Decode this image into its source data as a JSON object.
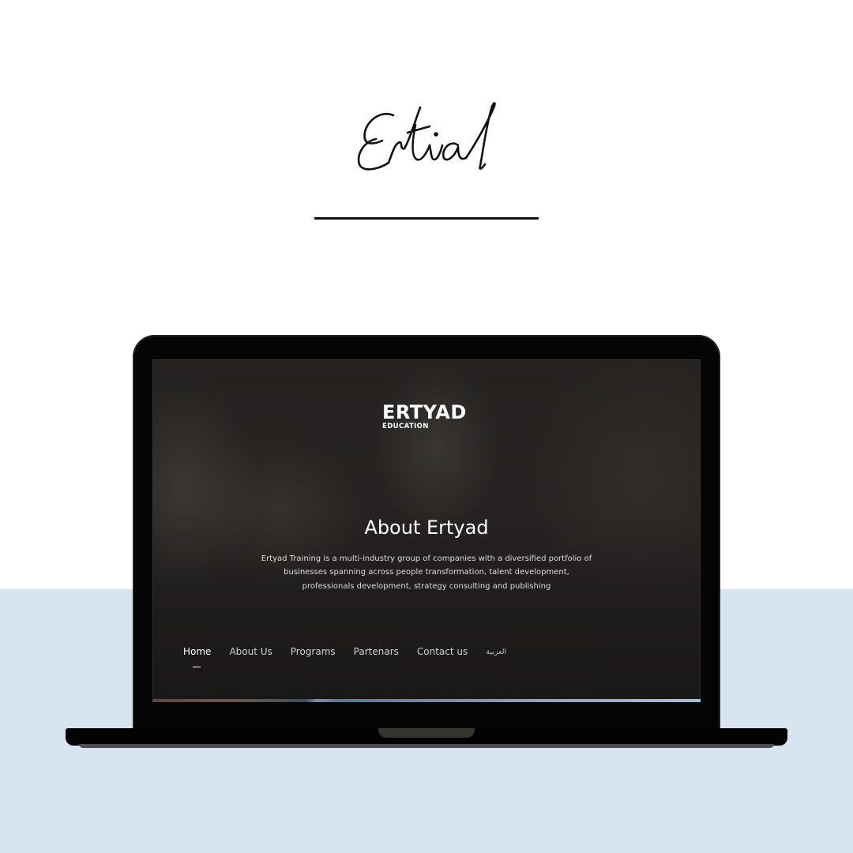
{
  "signature": {
    "text": "Ertial"
  },
  "colors": {
    "background_top": "#ffffff",
    "background_band": "#d8e5f0",
    "laptop": "#050505",
    "screen_overlay": "#262322",
    "text_primary": "#ffffff"
  },
  "site": {
    "logo": {
      "main": "ERTYAD",
      "sub": "EDUCATION"
    },
    "hero": {
      "title": "About Ertyad",
      "lines": [
        "Ertyad Training is a multi-industry group of companies with a diversified portfolio of",
        "businesses spanning across people transformation, talent development,",
        "professionals development, strategy consulting and publishing"
      ]
    },
    "nav": {
      "items": [
        {
          "label": "Home",
          "active": true
        },
        {
          "label": "About Us",
          "active": false
        },
        {
          "label": "Programs",
          "active": false
        },
        {
          "label": "Partenars",
          "active": false
        },
        {
          "label": "Contact us",
          "active": false
        },
        {
          "label": "العربية",
          "active": false
        }
      ]
    }
  }
}
